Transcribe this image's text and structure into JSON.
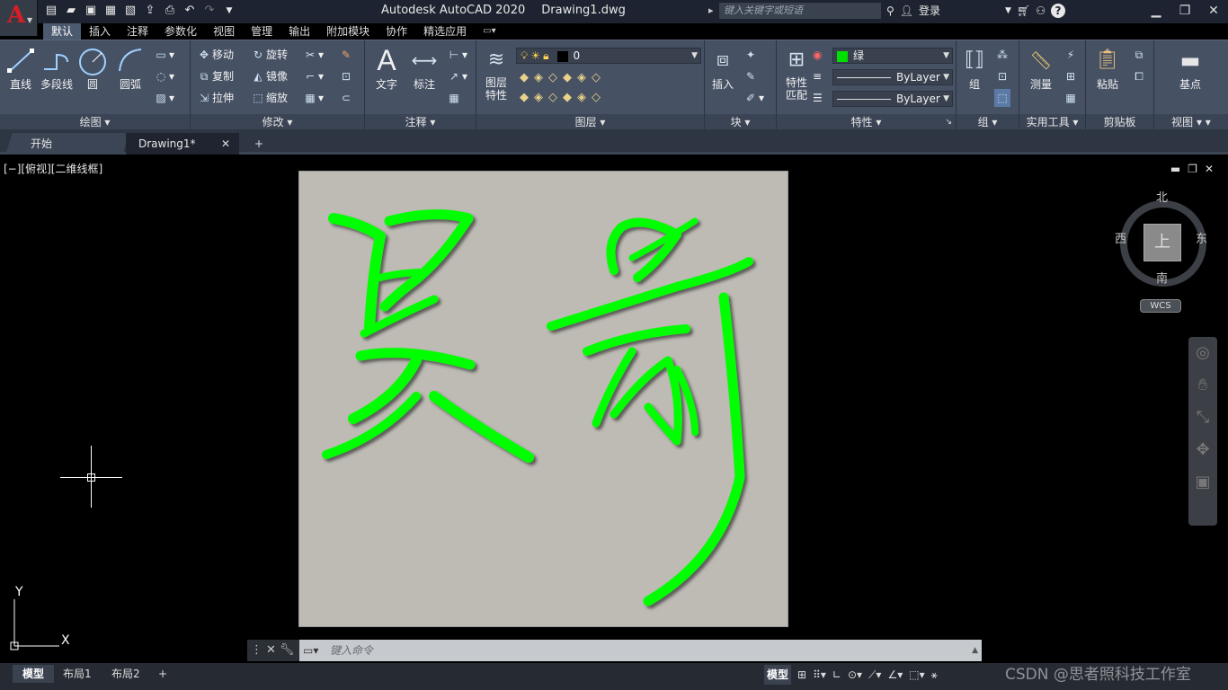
{
  "app": {
    "logo_letter": "A",
    "title": "Autodesk AutoCAD 2020",
    "document": "Drawing1.dwg",
    "search_placeholder": "键入关键字或短语",
    "login": "登录",
    "help": "?"
  },
  "menu_tabs": [
    "默认",
    "插入",
    "注释",
    "参数化",
    "视图",
    "管理",
    "输出",
    "附加模块",
    "协作",
    "精选应用"
  ],
  "ribbon": {
    "draw": {
      "title": "绘图",
      "line": "直线",
      "polyline": "多段线",
      "circle": "圆",
      "arc": "圆弧"
    },
    "modify": {
      "title": "修改",
      "move": "移动",
      "rotate": "旋转",
      "copy": "复制",
      "mirror": "镜像",
      "stretch": "拉伸",
      "scale": "缩放"
    },
    "annotation": {
      "title": "注释",
      "text": "文字",
      "dimension": "标注"
    },
    "layers": {
      "title": "图层",
      "properties_line1": "图层",
      "properties_line2": "特性",
      "current_layer": "0"
    },
    "block": {
      "title": "块",
      "insert": "插入"
    },
    "properties": {
      "title": "特性",
      "match_line1": "特性",
      "match_line2": "匹配",
      "color_name": "绿",
      "color_hex": "#00e000",
      "linetype": "ByLayer",
      "lineweight": "ByLayer"
    },
    "groups": {
      "title": "组",
      "group": "组"
    },
    "utilities": {
      "title": "实用工具",
      "measure": "测量"
    },
    "clipboard": {
      "title": "剪贴板",
      "paste": "粘贴"
    },
    "view": {
      "title": "视图",
      "base": "基点"
    }
  },
  "doc_tabs": {
    "start": "开始",
    "current": "Drawing1*"
  },
  "viewport": {
    "controls": "[−][俯视][二维线框]"
  },
  "viewcube": {
    "north": "北",
    "south": "南",
    "east": "东",
    "west": "西",
    "face": "上",
    "wcs": "WCS"
  },
  "ucs": {
    "x": "X",
    "y": "Y"
  },
  "command": {
    "placeholder": "键入命令"
  },
  "layout_tabs": [
    "模型",
    "布局1",
    "布局2"
  ],
  "status": {
    "model": "模型"
  },
  "watermark": "CSDN @思者照科技工作室"
}
